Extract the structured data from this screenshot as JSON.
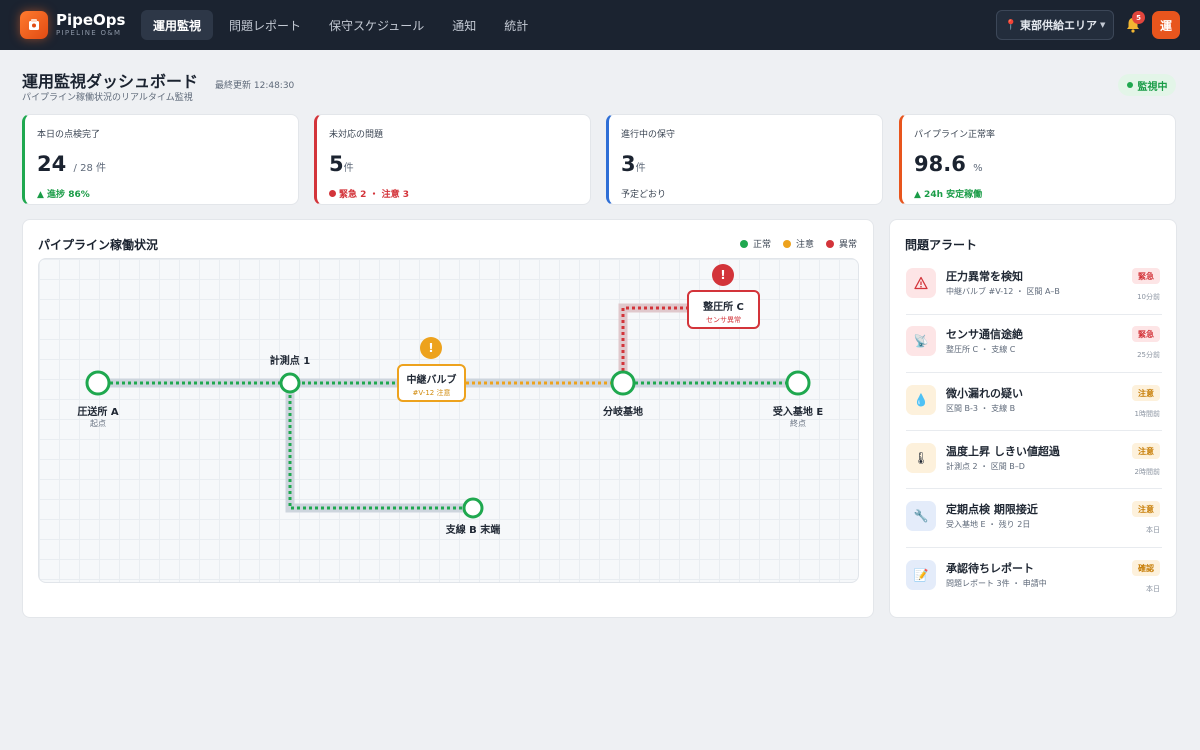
{
  "app": {
    "name": "PipeOps",
    "subtitle": "PIPELINE O&M"
  },
  "nav": [
    {
      "label": "運用監視",
      "active": true
    },
    {
      "label": "問題レポート"
    },
    {
      "label": "保守スケジュール"
    },
    {
      "label": "通知"
    },
    {
      "label": "統計"
    }
  ],
  "area": {
    "label": "東部供給エリア"
  },
  "notifications": {
    "count": "5"
  },
  "user": {
    "avatar": "運"
  },
  "header": {
    "title": "運用監視ダッシュボード",
    "last_update": "最終更新 12:48:30",
    "subtitle": "パイプライン稼働状況のリアルタイム監視",
    "status": "監視中"
  },
  "kpis": [
    {
      "label": "本日の点検完了",
      "value": "24",
      "unit": "/ 28 件",
      "foot": "▲ 進捗 86%",
      "accent": "#1fa84f"
    },
    {
      "label": "未対応の問題",
      "value": "5",
      "unit": "件",
      "foot": "緊急 2 ・ 注意 3",
      "accent": "#d3343a"
    },
    {
      "label": "進行中の保守",
      "value": "3",
      "unit": "件",
      "foot": "予定どおり",
      "accent": "#2f6fd6"
    },
    {
      "label": "パイプライン正常率",
      "value": "98.6",
      "unit": "%",
      "foot": "▲ 24h 安定稼働",
      "accent": "#e8551d"
    }
  ],
  "pipeline": {
    "title": "パイプライン稼働状況",
    "legend": [
      {
        "label": "正常",
        "color": "#1fa84f"
      },
      {
        "label": "注意",
        "color": "#eda21d"
      },
      {
        "label": "異常",
        "color": "#d3343a"
      }
    ],
    "nodes": {
      "source": {
        "label": "圧送所 A",
        "sub": "起点"
      },
      "meter1": {
        "label": "計測点 1"
      },
      "valve": {
        "label": "中継バルブ",
        "sub": "#V-12 注意"
      },
      "branch": {
        "label": "分岐基地"
      },
      "receiver": {
        "label": "受入基地 E",
        "sub": "終点"
      },
      "regulator": {
        "label": "整圧所 C",
        "sub": "センサ異常"
      },
      "branch_end": {
        "label": "支線 B 末端"
      }
    },
    "markers": {
      "warning": "!",
      "error": "!"
    }
  },
  "alerts": {
    "title": "問題アラート",
    "items": [
      {
        "title": "圧力異常を検知",
        "detail": "中継バルブ #V-12 ・ 区間 A–B",
        "badge": "緊急",
        "time": "10分前",
        "icon": "warning-triangle-icon",
        "level": "critical"
      },
      {
        "title": "センサ通信途絶",
        "detail": "整圧所 C ・ 支線 C",
        "badge": "緊急",
        "time": "25分前",
        "icon": "satellite-icon",
        "level": "critical"
      },
      {
        "title": "微小漏れの疑い",
        "detail": "区間 B-3 ・ 支線 B",
        "badge": "注意",
        "time": "1時間前",
        "icon": "droplet-icon",
        "level": "warning"
      },
      {
        "title": "温度上昇 しきい値超過",
        "detail": "計測点 2 ・ 区間 B–D",
        "badge": "注意",
        "time": "2時間前",
        "icon": "thermometer-icon",
        "level": "warning"
      },
      {
        "title": "定期点検 期限接近",
        "detail": "受入基地 E ・ 残り 2日",
        "badge": "注意",
        "time": "本日",
        "icon": "wrench-icon",
        "level": "warning"
      },
      {
        "title": "承認待ちレポート",
        "detail": "問題レポート 3件 ・ 申請中",
        "badge": "確認",
        "time": "本日",
        "icon": "memo-icon",
        "level": "info"
      }
    ]
  }
}
